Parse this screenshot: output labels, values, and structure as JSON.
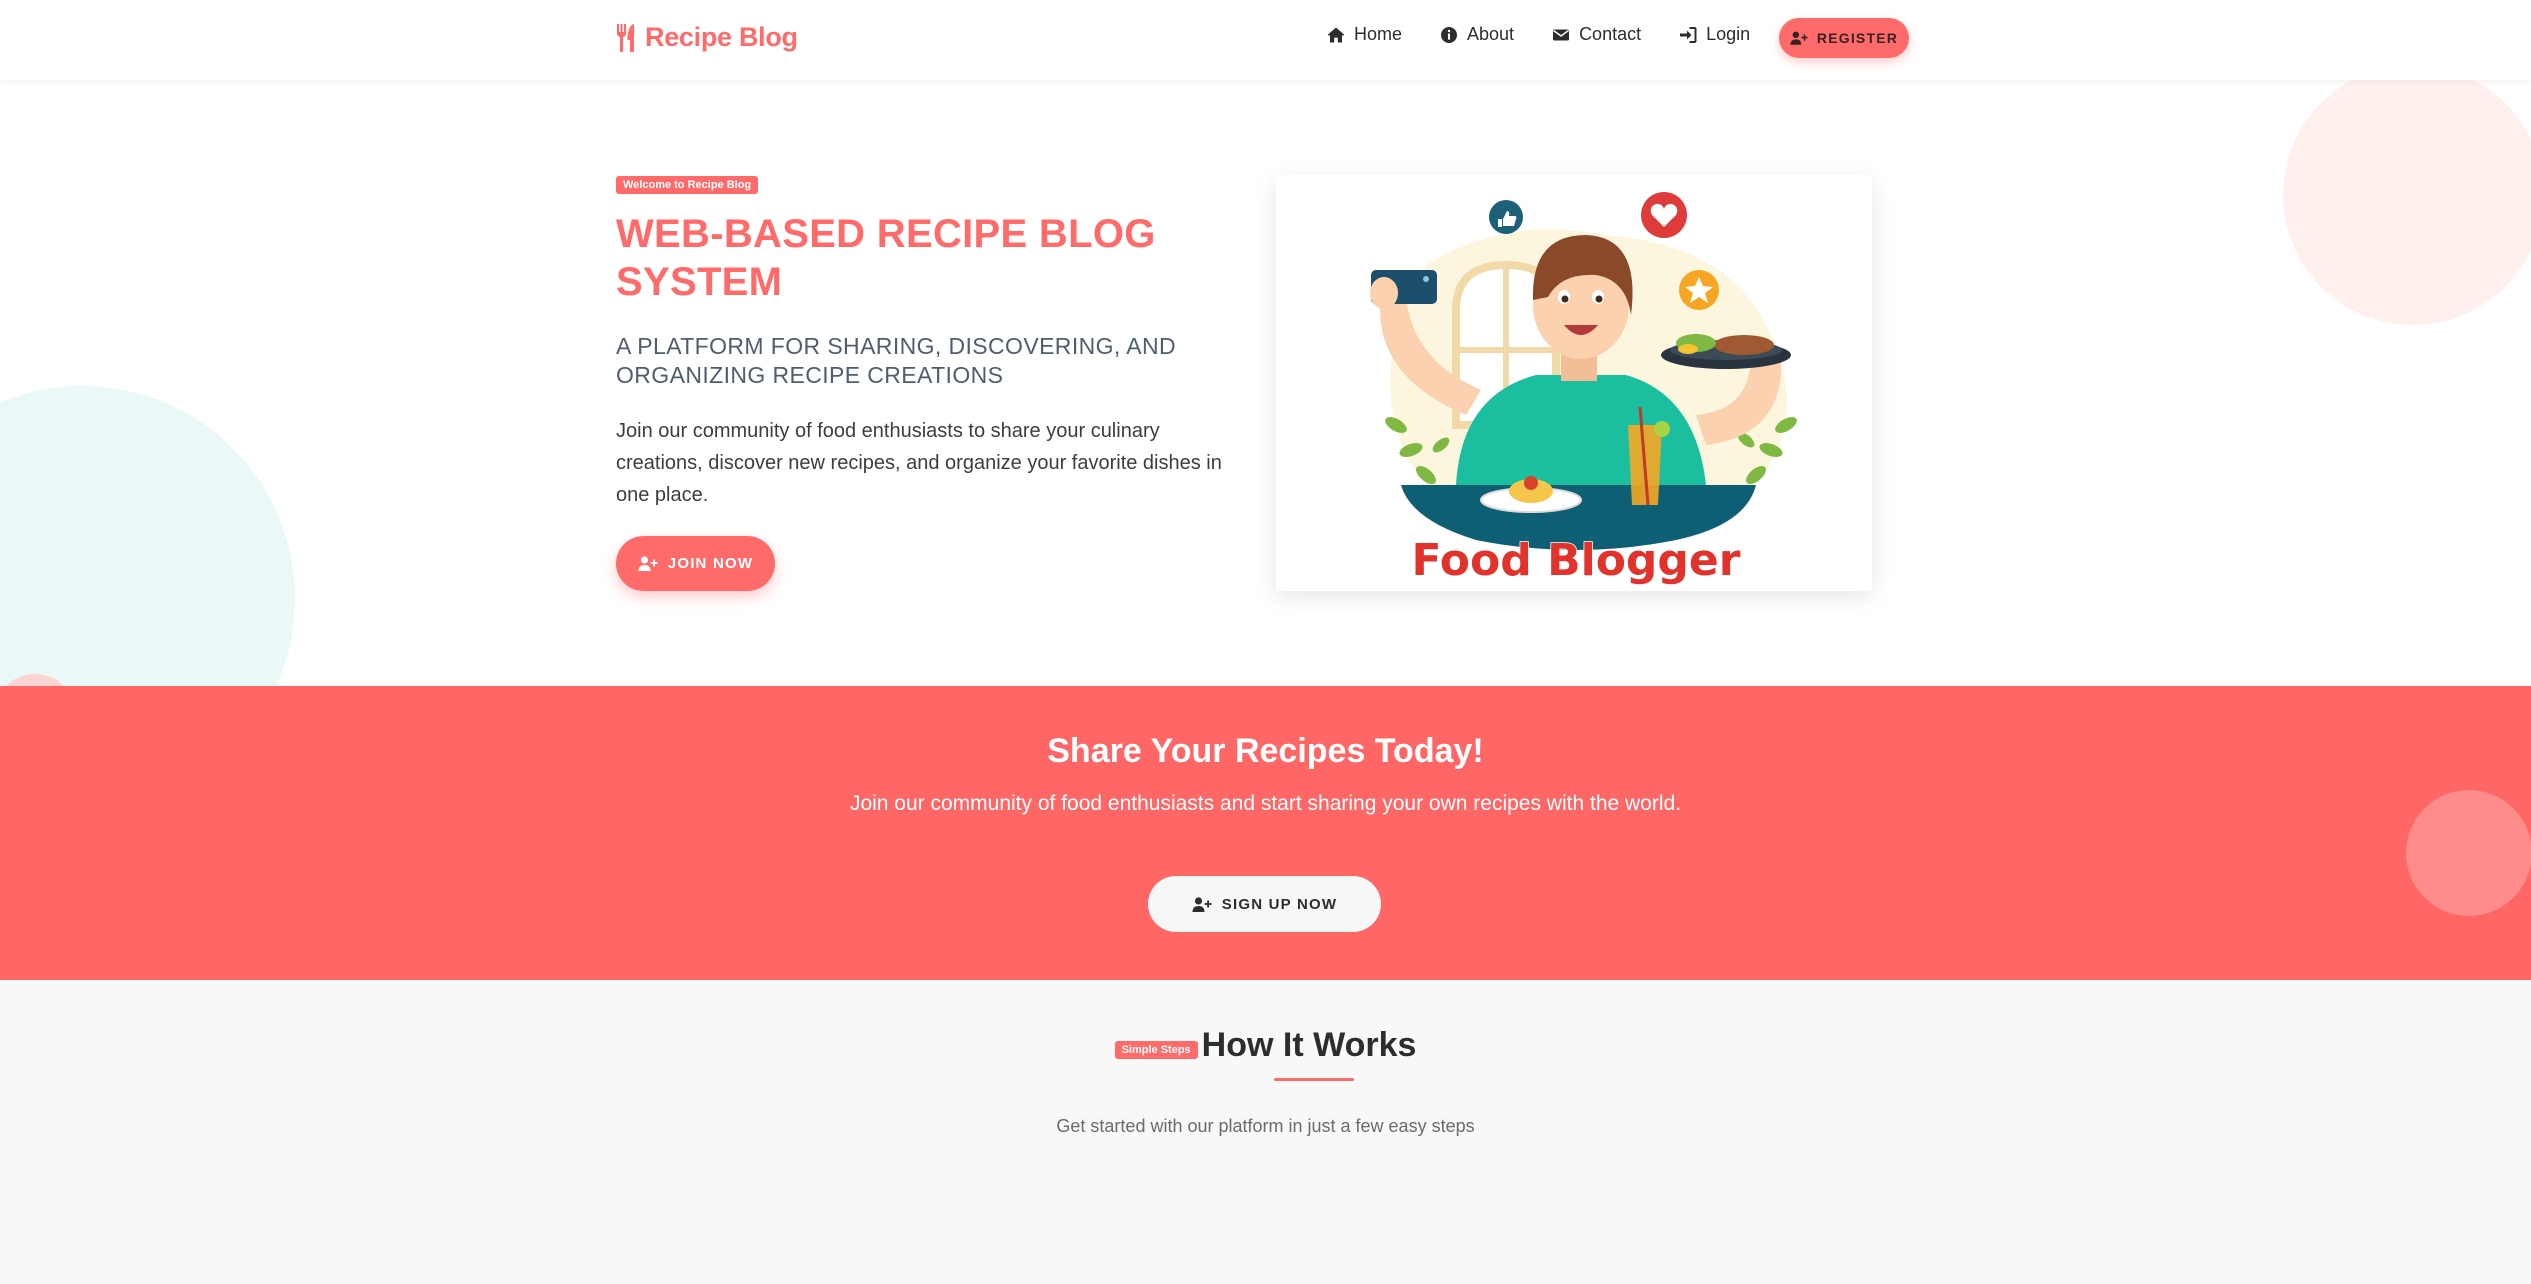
{
  "nav": {
    "brand": "Recipe Blog",
    "links": [
      {
        "label": "Home",
        "icon": "home-icon"
      },
      {
        "label": "About",
        "icon": "info-icon"
      },
      {
        "label": "Contact",
        "icon": "envelope-icon"
      },
      {
        "label": "Login",
        "icon": "sign-in-icon"
      }
    ],
    "register_label": "REGISTER"
  },
  "hero": {
    "badge": "Welcome to Recipe Blog",
    "title": "WEB-BASED RECIPE BLOG SYSTEM",
    "subtitle": "A PLATFORM FOR SHARING, DISCOVERING, AND ORGANIZING RECIPE CREATIONS",
    "description": "Join our community of food enthusiasts to share your culinary creations, discover new recipes, and organize your favorite dishes in one place.",
    "join_label": "JOIN NOW",
    "illustration_text": "Food Blogger"
  },
  "cta": {
    "title": "Share Your Recipes Today!",
    "description": "Join our community of food enthusiasts and start sharing your own recipes with the world.",
    "signup_label": "SIGN UP NOW"
  },
  "how": {
    "badge": "Simple Steps",
    "title": "How It Works",
    "description": "Get started with our platform in just a few easy steps"
  },
  "colors": {
    "accent": "#ff6b6b",
    "cta_background": "#ff6767",
    "subtitle": "#4f5d6e",
    "section_background": "#f8f8f8"
  }
}
